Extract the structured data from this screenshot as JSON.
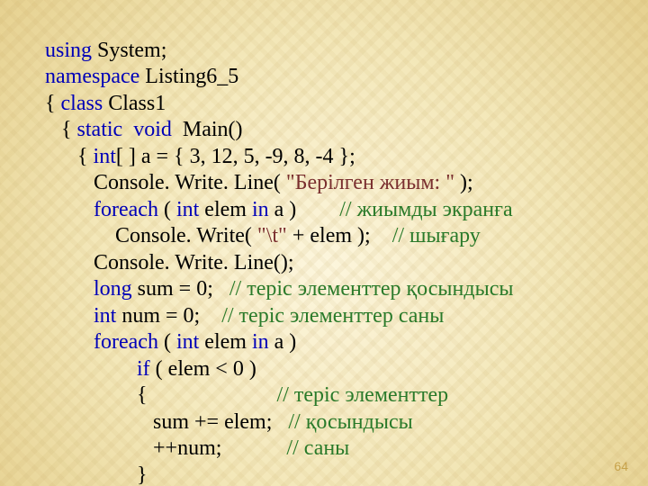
{
  "code": {
    "l1_using": "using",
    "l1_rest": " System;",
    "l2_ns": "namespace",
    "l2_rest": " Listing6_5",
    "l3": "{ ",
    "l3_class": "class",
    "l3_rest": " Class1",
    "l4a": "   { ",
    "l4_static": "static",
    "l4_sp1": "  ",
    "l4_void": "void",
    "l4_rest": "  Main()",
    "l5a": "      { ",
    "l5_int": "int",
    "l5_rest": "[ ] a = { 3, 12, 5, -9, 8, -4 };",
    "l6a": "         Console. Write. Line( ",
    "l6_str": "\"Берілген жиым: \"",
    "l6b": " );",
    "l7a": "         ",
    "l7_foreach": "foreach",
    "l7b": " ( ",
    "l7_int": "int",
    "l7c": " elem ",
    "l7_in": "in",
    "l7d": " a )        ",
    "l7_cmt": "// жиымды экранға",
    "l8a": "             Console. Write( ",
    "l8_str": "\"\\t\"",
    "l8b": " + elem );    ",
    "l8_cmt": "// шығару",
    "l9": "         Console. Write. Line();",
    "l10a": "         ",
    "l10_long": "long",
    "l10b": " sum = 0;   ",
    "l10_cmt": "// теріс элементтер қосындысы",
    "l11a": "         ",
    "l11_int": "int",
    "l11b": " num = 0;    ",
    "l11_cmt": "// теріс элементтер саны",
    "l12a": "         ",
    "l12_foreach": "foreach",
    "l12b": " ( ",
    "l12_int": "int",
    "l12c": " elem ",
    "l12_in": "in",
    "l12d": " a )",
    "l13a": "                 ",
    "l13_if": "if",
    "l13b": " ( elem < 0 )",
    "l14a": "                 {                        ",
    "l14_cmt": "// теріс элементтер",
    "l15a": "                    sum += elem;   ",
    "l15_cmt": "// қосындысы",
    "l16a": "                    ++num;            ",
    "l16_cmt": "// саны",
    "l17": "                 }"
  },
  "page_number": "64"
}
